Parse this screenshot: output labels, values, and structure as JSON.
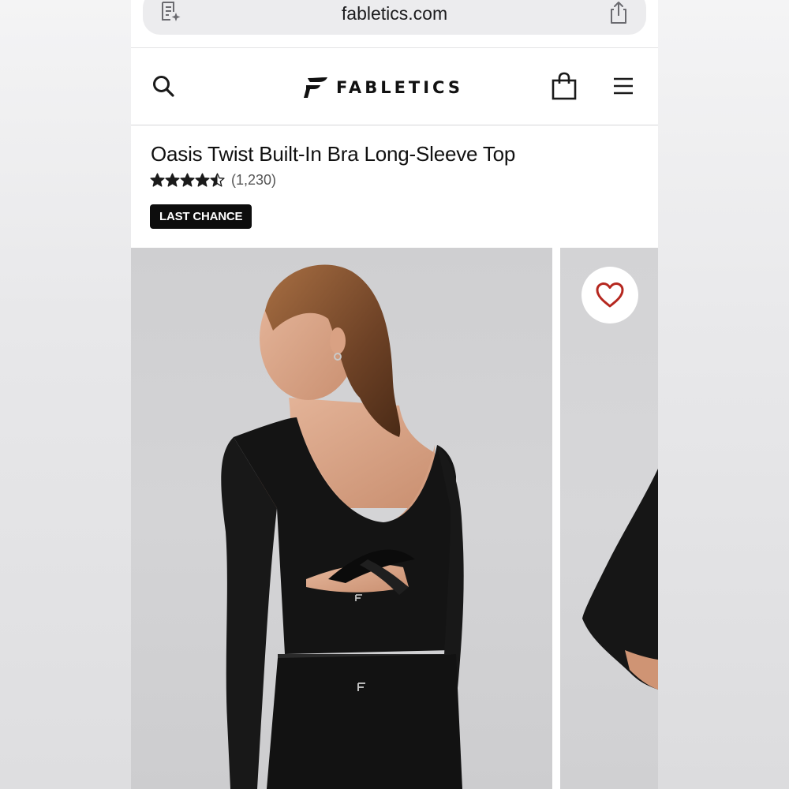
{
  "browser": {
    "url": "fabletics.com",
    "reader_icon": "reader-view-icon",
    "share_icon": "share-icon"
  },
  "header": {
    "brand": "FABLETICS",
    "search_icon": "search-icon",
    "bag_icon": "shopping-bag-icon",
    "menu_icon": "hamburger-menu-icon"
  },
  "product": {
    "title": "Oasis Twist Built-In Bra Long-Sleeve Top",
    "rating": 4.5,
    "rating_max": 5,
    "review_count": "(1,230)",
    "badge": "LAST CHANCE"
  },
  "gallery": {
    "wishlist_icon": "heart-icon",
    "colors": {
      "heart": "#b5271f",
      "badge_bg": "#0d0d0d",
      "garment": "#141414"
    }
  }
}
